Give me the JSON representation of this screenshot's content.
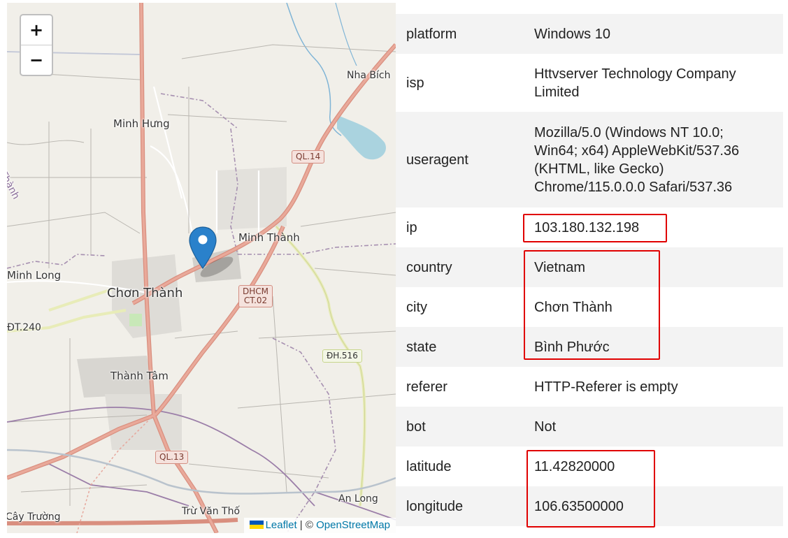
{
  "map": {
    "zoom_in_label": "+",
    "zoom_out_label": "−",
    "places": {
      "minh_hung": "Minh Hưng",
      "nha_bich": "Nha Bích",
      "minh_thanh": "Minh Thành",
      "minh_long": "Minh Long",
      "chon_thanh": "Chơn Thành",
      "thanh_tam": "Thành Tâm",
      "an_long": "An Long",
      "tru_van_tho": "Trừ Văn Thố",
      "cay_truong": "Cây Trường",
      "edge_label": "n Thành",
      "dt240": "ĐT.240"
    },
    "shields": {
      "ql14": "QL.14",
      "dhcm_1": "DHCM",
      "dhcm_2": "CT.02",
      "dh516": "ĐH.516",
      "ql13": "QL.13"
    },
    "attribution": {
      "leaflet": "Leaflet",
      "separator": " | © ",
      "osm": "OpenStreetMap"
    },
    "icons": [
      "map-marker-icon",
      "ukraine-flag-icon"
    ]
  },
  "info": {
    "rows": [
      {
        "key": "platform",
        "value": "Windows 10"
      },
      {
        "key": "isp",
        "value": "Httvserver Technology Company Limited"
      },
      {
        "key": "useragent",
        "value": "Mozilla/5.0 (Windows NT 10.0; Win64; x64) AppleWebKit/537.36 (KHTML, like Gecko) Chrome/115.0.0.0 Safari/537.36"
      },
      {
        "key": "ip",
        "value": "103.180.132.198"
      },
      {
        "key": "country",
        "value": "Vietnam"
      },
      {
        "key": "city",
        "value": "Chơn Thành"
      },
      {
        "key": "state",
        "value": "Bình Phước"
      },
      {
        "key": "referer",
        "value": "HTTP-Referer is empty"
      },
      {
        "key": "bot",
        "value": "Not"
      },
      {
        "key": "latitude",
        "value": "11.42820000"
      },
      {
        "key": "longitude",
        "value": "106.63500000"
      }
    ]
  },
  "colors": {
    "highlight": "#e00000",
    "row_stripe": "#f3f3f3",
    "map_background": "#f1efe9",
    "primary_road": "#e8a08d",
    "water": "#aad3df",
    "link": "#0078a8"
  }
}
